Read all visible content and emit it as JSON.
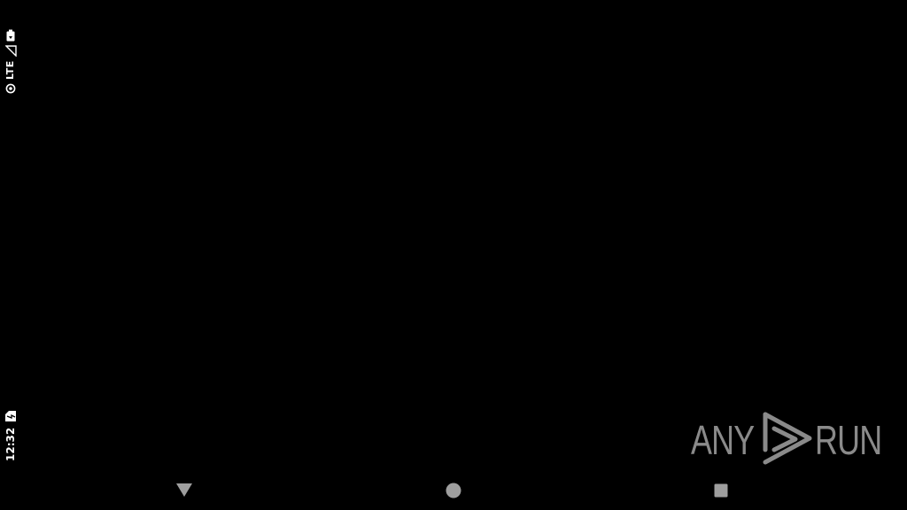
{
  "status_bar": {
    "network_type": "LTE",
    "time": "12:32",
    "icons": [
      "battery-icon",
      "signal-icon",
      "location-icon",
      "sim-card-icon"
    ]
  },
  "navigation_bar": {
    "buttons": [
      "back-button",
      "home-button",
      "recents-button"
    ]
  },
  "watermark": {
    "left_text": "ANY",
    "right_text": "RUN",
    "color": "#b8b8b8"
  },
  "colors": {
    "background": "#000000",
    "status_icons": "#ffffff",
    "nav_buttons": "#9e9e9e"
  }
}
